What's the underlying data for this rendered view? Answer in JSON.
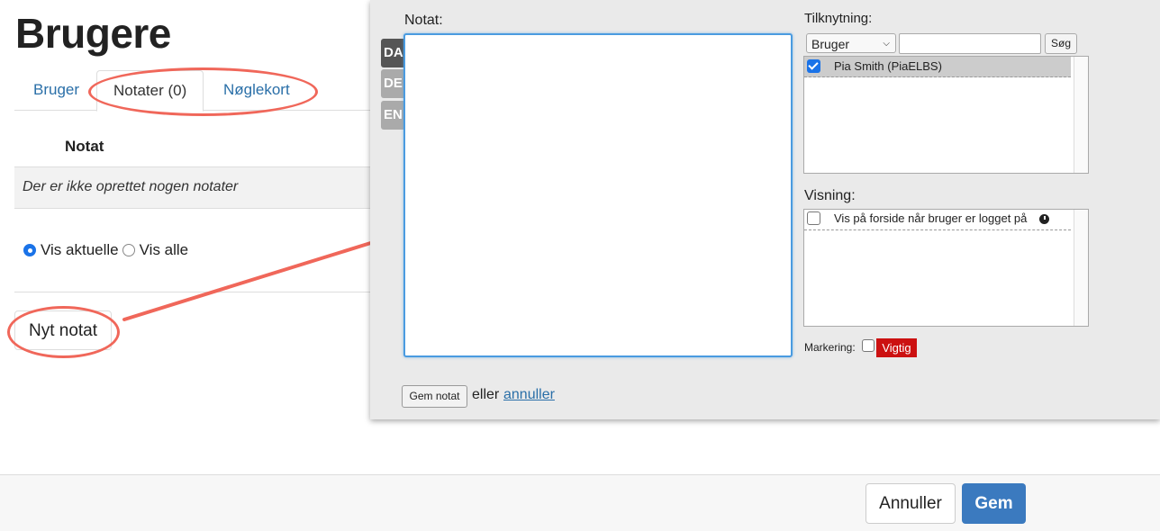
{
  "page": {
    "title": "Brugere"
  },
  "tabs": [
    {
      "label": "Bruger"
    },
    {
      "label": "Notater (0)"
    },
    {
      "label": "Nøglekort"
    }
  ],
  "notes_table": {
    "column_header": "Notat",
    "empty_message": "Der er ikke oprettet nogen notater"
  },
  "filter": {
    "options": [
      "Vis aktuelle",
      "Vis alle"
    ],
    "selected": "Vis aktuelle"
  },
  "new_note_button": "Nyt notat",
  "modal": {
    "language_tabs": [
      "DA",
      "DE",
      "EN"
    ],
    "active_language": "DA",
    "note_label": "Notat:",
    "note_value": "",
    "association": {
      "label": "Tilknytning:",
      "type_selected": "Bruger",
      "search_value": "",
      "search_button": "Søg",
      "items": [
        {
          "label": "Pia Smith (PiaELBS)",
          "checked": true
        }
      ]
    },
    "display": {
      "label": "Visning:",
      "items": [
        {
          "label": "Vis på forside når bruger er logget på",
          "checked": false,
          "icon": "clock-icon"
        }
      ]
    },
    "marking": {
      "label": "Markering:",
      "checked": false,
      "tag": "Vigtig",
      "tag_color": "#cc1111"
    },
    "save_button": "Gem notat",
    "or_text": "eller",
    "cancel_link": "annuller"
  },
  "footer": {
    "cancel_button": "Annuller",
    "save_button": "Gem",
    "save_color": "#3b7abf"
  },
  "annotation_color": "#f0675a"
}
